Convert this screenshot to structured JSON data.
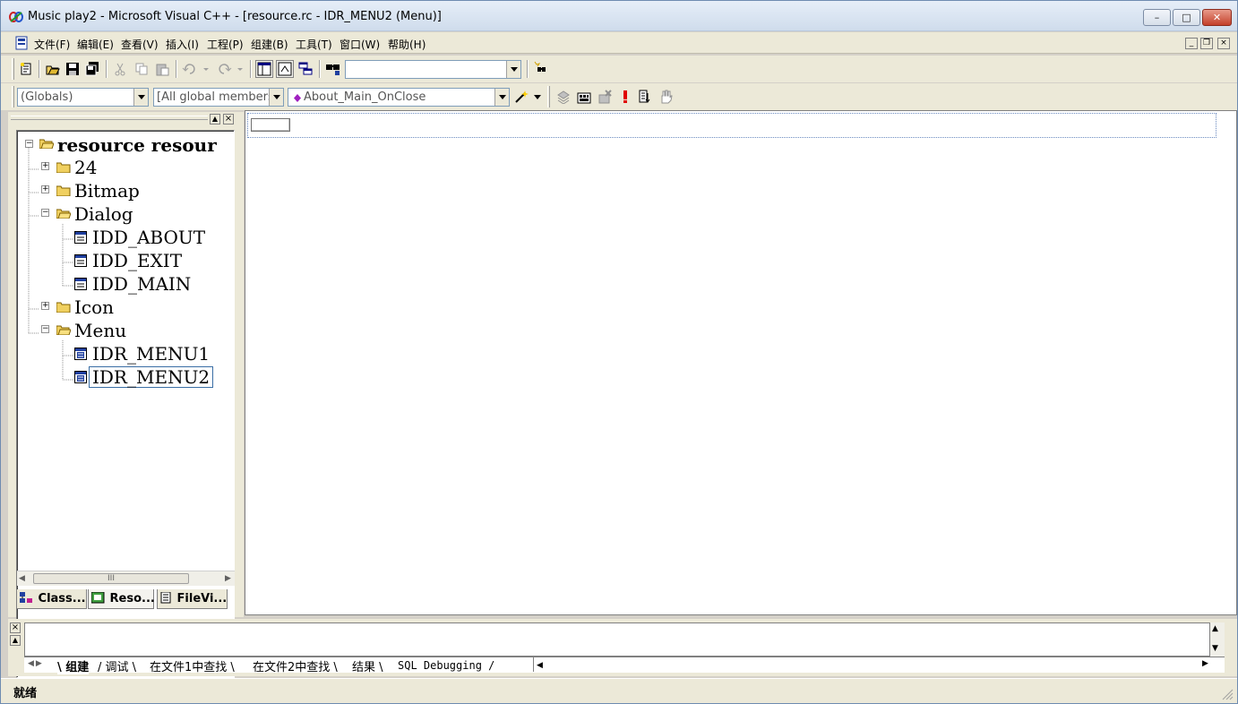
{
  "window": {
    "title": "Music play2 - Microsoft Visual C++ - [resource.rc - IDR_MENU2 (Menu)]",
    "minimize": "–",
    "maximize": "□",
    "close": "✕"
  },
  "menubar": {
    "items": [
      "文件(F)",
      "编辑(E)",
      "查看(V)",
      "插入(I)",
      "工程(P)",
      "组建(B)",
      "工具(T)",
      "窗口(W)",
      "帮助(H)"
    ],
    "mdi_controls": [
      "_",
      "❐",
      "×"
    ]
  },
  "toolbar1": {
    "find_combo_value": ""
  },
  "toolbar2": {
    "scope_combo": "(Globals)",
    "members_combo": "[All global members",
    "function_combo": "About_Main_OnClose"
  },
  "workspace": {
    "tree": {
      "root": "resource resour",
      "folders": [
        "24",
        "Bitmap",
        "Dialog",
        "Icon",
        "Menu"
      ],
      "dialog_items": [
        "IDD_ABOUT",
        "IDD_EXIT",
        "IDD_MAIN"
      ],
      "menu_items": [
        "IDR_MENU1",
        "IDR_MENU2"
      ]
    },
    "hscroll_grip": "III",
    "tabs": [
      "Class...",
      "Reso...",
      "FileVi..."
    ]
  },
  "output": {
    "tabs": [
      "组建",
      "调试",
      "在文件1中查找",
      "在文件2中查找",
      "结果",
      "SQL Debugging"
    ]
  },
  "statusbar": {
    "text": "就绪"
  },
  "colors": {
    "selection_border": "#3a6ea5",
    "menu_icon_blue": "#2040a0",
    "folder_yellow": "#f0d060"
  }
}
